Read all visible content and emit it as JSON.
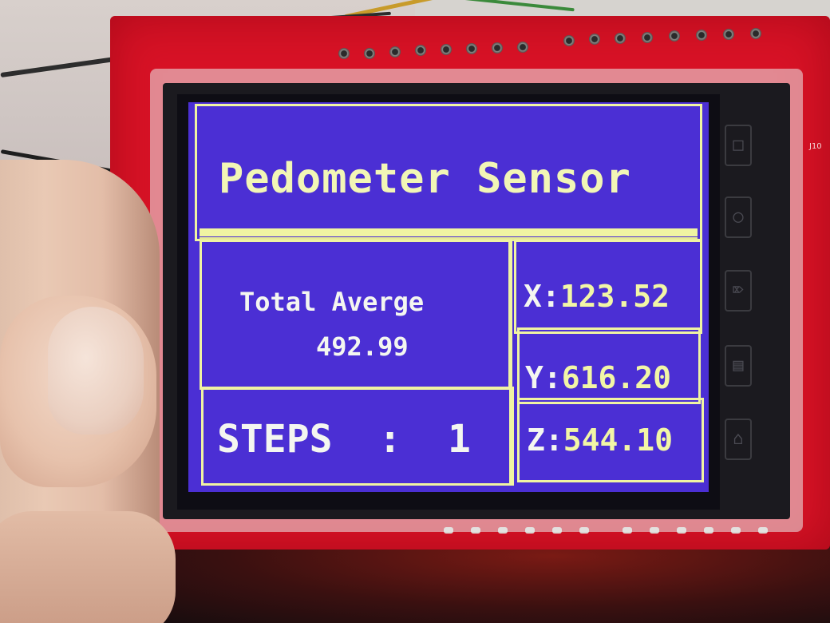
{
  "screen": {
    "title": "Pedometer Sensor",
    "total_average_label": "Total Averge",
    "total_average_value": "492.99",
    "steps_text": "STEPS  :  1",
    "axes": [
      {
        "letter": "X",
        "sep": ":",
        "value": "123.52"
      },
      {
        "letter": "Y",
        "sep": ":",
        "value": "616.20"
      },
      {
        "letter": "Z",
        "sep": ":",
        "value": "544.10"
      }
    ]
  },
  "board": {
    "silkscreen_label": "J10"
  },
  "side_icons": [
    "document-icon",
    "camera-icon",
    "play-icon",
    "menu-icon",
    "home-icon"
  ],
  "colors": {
    "screen_background": "#4b2fd4",
    "screen_foreground": "#f0f4a2",
    "board": "#d81226"
  }
}
